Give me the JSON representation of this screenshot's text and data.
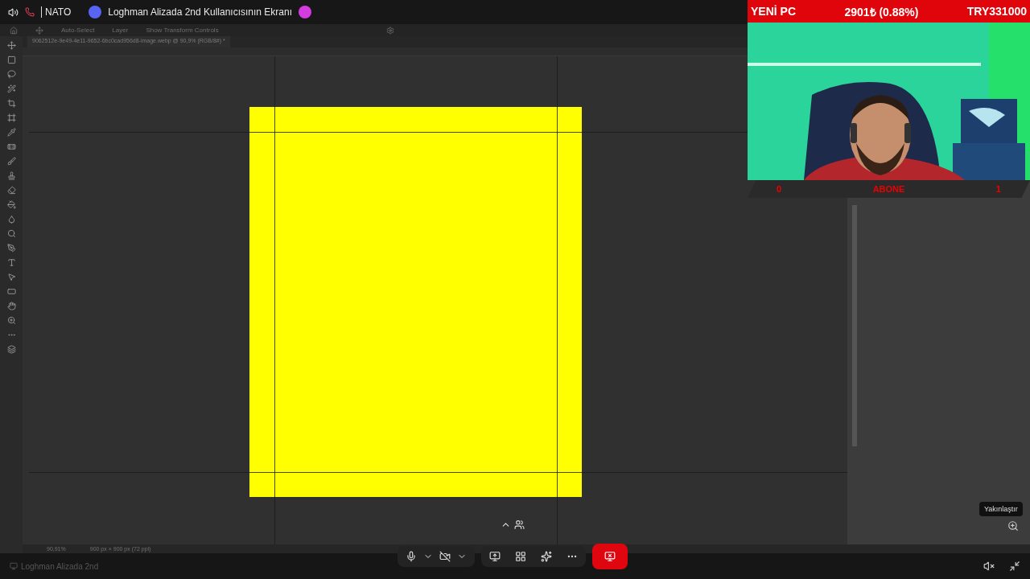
{
  "call": {
    "channel": "NATO",
    "stream_title": "Loghman Alizada 2nd Kullanıcısının Ekranı"
  },
  "editor": {
    "options": [
      "Auto-Select",
      "Layer",
      "Show Transform Controls"
    ],
    "document_tab": "9062512e-9e49-4e11-9652-6bc0cad956d8-image.webp @ 90,9% (RGB/8#) *",
    "zoom": "90,91%",
    "doc_info": "900 px × 900 px (72 ppi)"
  },
  "overlay": {
    "ticker": [
      "YENİ PC",
      "2901₺ (0.88%)",
      "TRY331000"
    ],
    "counter": [
      "0",
      "ABONE",
      "1"
    ]
  },
  "footer": {
    "streamer": "Loghman Alizada 2nd"
  },
  "tooltip": "Yakınlaştır"
}
